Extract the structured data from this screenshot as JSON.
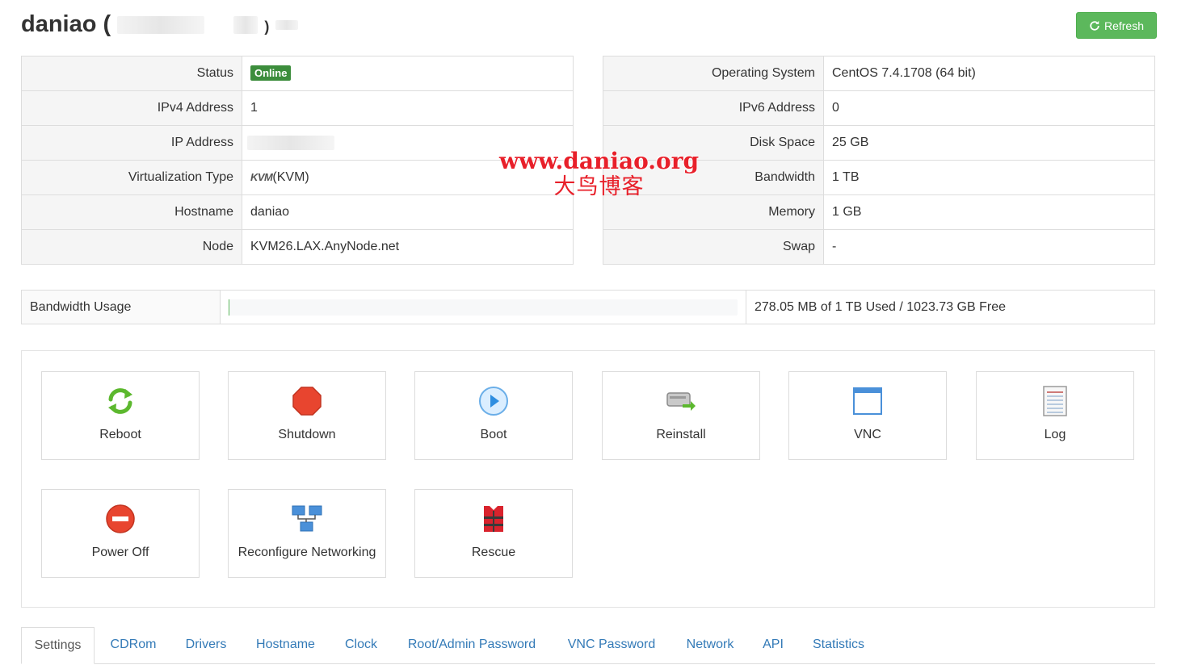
{
  "header": {
    "title": "daniao",
    "open_paren": "(",
    "close_paren": ")",
    "refresh_label": "Refresh"
  },
  "left_info": [
    {
      "label": "Status",
      "value": "Online"
    },
    {
      "label": "IPv4 Address",
      "value": "1"
    },
    {
      "label": "IP Address",
      "value": ""
    },
    {
      "label": "Virtualization Type",
      "value_logo": "KVM",
      "value": "(KVM)"
    },
    {
      "label": "Hostname",
      "value": "daniao"
    },
    {
      "label": "Node",
      "value": "KVM26.LAX.AnyNode.net"
    }
  ],
  "right_info": [
    {
      "label": "Operating System",
      "value": "CentOS 7.4.1708 (64 bit)"
    },
    {
      "label": "IPv6 Address",
      "value": "0"
    },
    {
      "label": "Disk Space",
      "value": "25 GB"
    },
    {
      "label": "Bandwidth",
      "value": "1 TB"
    },
    {
      "label": "Memory",
      "value": "1 GB"
    },
    {
      "label": "Swap",
      "value": "-"
    }
  ],
  "watermark": {
    "line1": "www.daniao.org",
    "line2": "大鸟博客"
  },
  "bandwidth": {
    "label": "Bandwidth Usage",
    "usage_fraction": 0.0003,
    "text": "278.05 MB of 1 TB Used / 1023.73 GB Free"
  },
  "actions": [
    {
      "label": "Reboot",
      "icon": "reboot-icon"
    },
    {
      "label": "Shutdown",
      "icon": "shutdown-icon"
    },
    {
      "label": "Boot",
      "icon": "boot-icon"
    },
    {
      "label": "Reinstall",
      "icon": "reinstall-icon"
    },
    {
      "label": "VNC",
      "icon": "vnc-icon"
    },
    {
      "label": "Log",
      "icon": "log-icon"
    },
    {
      "label": "Power Off",
      "icon": "power-off-icon"
    },
    {
      "label": "Reconfigure Networking",
      "icon": "network-icon"
    },
    {
      "label": "Rescue",
      "icon": "rescue-icon"
    }
  ],
  "tabs": [
    {
      "label": "Settings",
      "active": true
    },
    {
      "label": "CDRom"
    },
    {
      "label": "Drivers"
    },
    {
      "label": "Hostname"
    },
    {
      "label": "Clock"
    },
    {
      "label": "Root/Admin Password"
    },
    {
      "label": "VNC Password"
    },
    {
      "label": "Network"
    },
    {
      "label": "API"
    },
    {
      "label": "Statistics"
    }
  ],
  "colors": {
    "success": "#5cb85c",
    "online_badge": "#3c8d3c",
    "link": "#337ab7",
    "watermark": "#e8202a"
  }
}
